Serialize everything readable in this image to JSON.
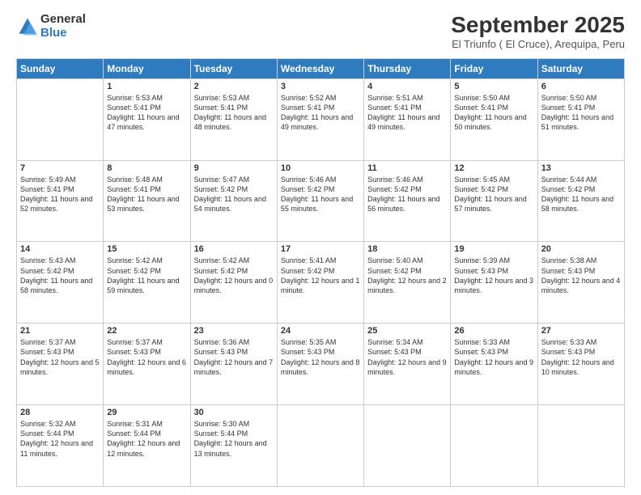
{
  "logo": {
    "general": "General",
    "blue": "Blue"
  },
  "title": "September 2025",
  "subtitle": "El Triunfo ( El Cruce), Arequipa, Peru",
  "weekdays": [
    "Sunday",
    "Monday",
    "Tuesday",
    "Wednesday",
    "Thursday",
    "Friday",
    "Saturday"
  ],
  "weeks": [
    [
      {
        "day": "",
        "sunrise": "",
        "sunset": "",
        "daylight": ""
      },
      {
        "day": "1",
        "sunrise": "Sunrise: 5:53 AM",
        "sunset": "Sunset: 5:41 PM",
        "daylight": "Daylight: 11 hours and 47 minutes."
      },
      {
        "day": "2",
        "sunrise": "Sunrise: 5:53 AM",
        "sunset": "Sunset: 5:41 PM",
        "daylight": "Daylight: 11 hours and 48 minutes."
      },
      {
        "day": "3",
        "sunrise": "Sunrise: 5:52 AM",
        "sunset": "Sunset: 5:41 PM",
        "daylight": "Daylight: 11 hours and 49 minutes."
      },
      {
        "day": "4",
        "sunrise": "Sunrise: 5:51 AM",
        "sunset": "Sunset: 5:41 PM",
        "daylight": "Daylight: 11 hours and 49 minutes."
      },
      {
        "day": "5",
        "sunrise": "Sunrise: 5:50 AM",
        "sunset": "Sunset: 5:41 PM",
        "daylight": "Daylight: 11 hours and 50 minutes."
      },
      {
        "day": "6",
        "sunrise": "Sunrise: 5:50 AM",
        "sunset": "Sunset: 5:41 PM",
        "daylight": "Daylight: 11 hours and 51 minutes."
      }
    ],
    [
      {
        "day": "7",
        "sunrise": "Sunrise: 5:49 AM",
        "sunset": "Sunset: 5:41 PM",
        "daylight": "Daylight: 11 hours and 52 minutes."
      },
      {
        "day": "8",
        "sunrise": "Sunrise: 5:48 AM",
        "sunset": "Sunset: 5:41 PM",
        "daylight": "Daylight: 11 hours and 53 minutes."
      },
      {
        "day": "9",
        "sunrise": "Sunrise: 5:47 AM",
        "sunset": "Sunset: 5:42 PM",
        "daylight": "Daylight: 11 hours and 54 minutes."
      },
      {
        "day": "10",
        "sunrise": "Sunrise: 5:46 AM",
        "sunset": "Sunset: 5:42 PM",
        "daylight": "Daylight: 11 hours and 55 minutes."
      },
      {
        "day": "11",
        "sunrise": "Sunrise: 5:46 AM",
        "sunset": "Sunset: 5:42 PM",
        "daylight": "Daylight: 11 hours and 56 minutes."
      },
      {
        "day": "12",
        "sunrise": "Sunrise: 5:45 AM",
        "sunset": "Sunset: 5:42 PM",
        "daylight": "Daylight: 11 hours and 57 minutes."
      },
      {
        "day": "13",
        "sunrise": "Sunrise: 5:44 AM",
        "sunset": "Sunset: 5:42 PM",
        "daylight": "Daylight: 11 hours and 58 minutes."
      }
    ],
    [
      {
        "day": "14",
        "sunrise": "Sunrise: 5:43 AM",
        "sunset": "Sunset: 5:42 PM",
        "daylight": "Daylight: 11 hours and 58 minutes."
      },
      {
        "day": "15",
        "sunrise": "Sunrise: 5:42 AM",
        "sunset": "Sunset: 5:42 PM",
        "daylight": "Daylight: 11 hours and 59 minutes."
      },
      {
        "day": "16",
        "sunrise": "Sunrise: 5:42 AM",
        "sunset": "Sunset: 5:42 PM",
        "daylight": "Daylight: 12 hours and 0 minutes."
      },
      {
        "day": "17",
        "sunrise": "Sunrise: 5:41 AM",
        "sunset": "Sunset: 5:42 PM",
        "daylight": "Daylight: 12 hours and 1 minute."
      },
      {
        "day": "18",
        "sunrise": "Sunrise: 5:40 AM",
        "sunset": "Sunset: 5:42 PM",
        "daylight": "Daylight: 12 hours and 2 minutes."
      },
      {
        "day": "19",
        "sunrise": "Sunrise: 5:39 AM",
        "sunset": "Sunset: 5:43 PM",
        "daylight": "Daylight: 12 hours and 3 minutes."
      },
      {
        "day": "20",
        "sunrise": "Sunrise: 5:38 AM",
        "sunset": "Sunset: 5:43 PM",
        "daylight": "Daylight: 12 hours and 4 minutes."
      }
    ],
    [
      {
        "day": "21",
        "sunrise": "Sunrise: 5:37 AM",
        "sunset": "Sunset: 5:43 PM",
        "daylight": "Daylight: 12 hours and 5 minutes."
      },
      {
        "day": "22",
        "sunrise": "Sunrise: 5:37 AM",
        "sunset": "Sunset: 5:43 PM",
        "daylight": "Daylight: 12 hours and 6 minutes."
      },
      {
        "day": "23",
        "sunrise": "Sunrise: 5:36 AM",
        "sunset": "Sunset: 5:43 PM",
        "daylight": "Daylight: 12 hours and 7 minutes."
      },
      {
        "day": "24",
        "sunrise": "Sunrise: 5:35 AM",
        "sunset": "Sunset: 5:43 PM",
        "daylight": "Daylight: 12 hours and 8 minutes."
      },
      {
        "day": "25",
        "sunrise": "Sunrise: 5:34 AM",
        "sunset": "Sunset: 5:43 PM",
        "daylight": "Daylight: 12 hours and 9 minutes."
      },
      {
        "day": "26",
        "sunrise": "Sunrise: 5:33 AM",
        "sunset": "Sunset: 5:43 PM",
        "daylight": "Daylight: 12 hours and 9 minutes."
      },
      {
        "day": "27",
        "sunrise": "Sunrise: 5:33 AM",
        "sunset": "Sunset: 5:43 PM",
        "daylight": "Daylight: 12 hours and 10 minutes."
      }
    ],
    [
      {
        "day": "28",
        "sunrise": "Sunrise: 5:32 AM",
        "sunset": "Sunset: 5:44 PM",
        "daylight": "Daylight: 12 hours and 11 minutes."
      },
      {
        "day": "29",
        "sunrise": "Sunrise: 5:31 AM",
        "sunset": "Sunset: 5:44 PM",
        "daylight": "Daylight: 12 hours and 12 minutes."
      },
      {
        "day": "30",
        "sunrise": "Sunrise: 5:30 AM",
        "sunset": "Sunset: 5:44 PM",
        "daylight": "Daylight: 12 hours and 13 minutes."
      },
      {
        "day": "",
        "sunrise": "",
        "sunset": "",
        "daylight": ""
      },
      {
        "day": "",
        "sunrise": "",
        "sunset": "",
        "daylight": ""
      },
      {
        "day": "",
        "sunrise": "",
        "sunset": "",
        "daylight": ""
      },
      {
        "day": "",
        "sunrise": "",
        "sunset": "",
        "daylight": ""
      }
    ]
  ]
}
